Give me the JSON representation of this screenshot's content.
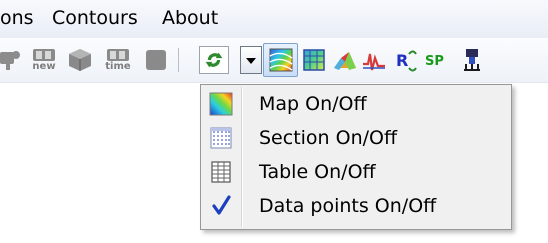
{
  "menubar": {
    "items": [
      {
        "label": "ons"
      },
      {
        "label": "Contours"
      },
      {
        "label": "About"
      }
    ]
  },
  "toolbar": {
    "gray_buttons": [
      {
        "icon": "partial-tool-icon"
      },
      {
        "icon": "bb-new-icon",
        "top_text": "BB",
        "bottom_text": "new"
      },
      {
        "icon": "cube-icon"
      },
      {
        "icon": "bb-time-icon",
        "top_text": "BB",
        "bottom_text": "time"
      },
      {
        "icon": "stop-icon"
      }
    ],
    "refresh_icon": "refresh-icon",
    "dropdown_arrow_icon": "dropdown-arrow-icon",
    "active_tool_icon": "map-icon",
    "tools": [
      {
        "icon": "grid-icon"
      },
      {
        "icon": "surface-3d-icon"
      },
      {
        "icon": "spectrum-icon"
      },
      {
        "icon": "phase-icon",
        "text": "R"
      },
      {
        "icon": "sp-icon",
        "text": "SP"
      },
      {
        "icon": "probe-icon"
      }
    ]
  },
  "dropdown": {
    "items": [
      {
        "label": "Map On/Off",
        "icon": "map-icon"
      },
      {
        "label": "Section On/Off",
        "icon": "section-icon"
      },
      {
        "label": "Table On/Off",
        "icon": "table-icon"
      },
      {
        "label": "Data points On/Off",
        "icon": "checkmark-icon"
      }
    ]
  },
  "colors": {
    "menu_text": "#000000",
    "check_blue": "#1c3fbf",
    "sp_green": "#1a9a1a",
    "refresh_green": "#2f8a2f"
  }
}
